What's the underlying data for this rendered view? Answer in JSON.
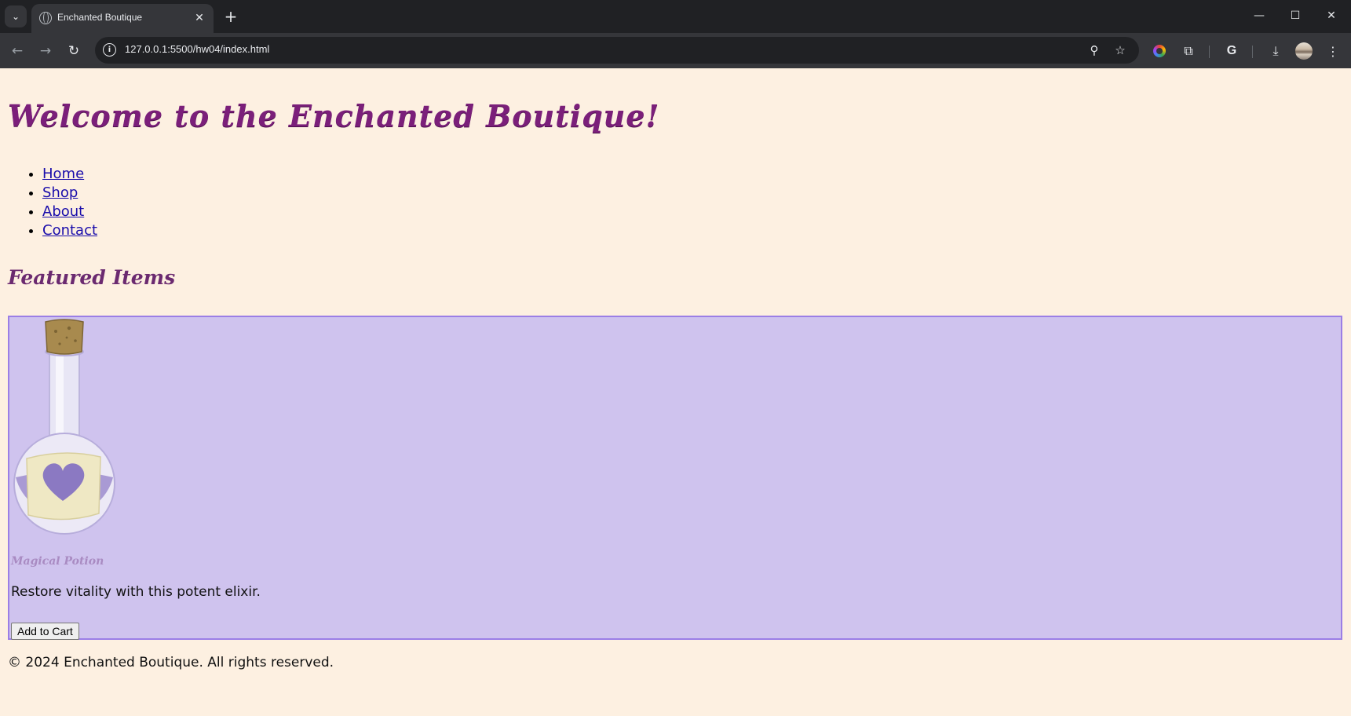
{
  "browser": {
    "tab_title": "Enchanted Boutique",
    "url": "127.0.0.1:5500/hw04/index.html",
    "new_tab_symbol": "+",
    "tab_close_symbol": "✕",
    "window_controls": {
      "minimize": "—",
      "maximize": "☐",
      "close": "✕"
    },
    "icons": [
      "tab-search-icon",
      "globe-icon",
      "back-icon",
      "forward-icon",
      "reload-icon",
      "site-info-icon",
      "zoom-icon",
      "bookmark-star-icon",
      "color-picker-icon",
      "extensions-icon",
      "google-icon",
      "download-icon",
      "profile-avatar-icon",
      "menu-icon"
    ]
  },
  "page": {
    "title": "Welcome to the Enchanted Boutique!",
    "nav": [
      {
        "label": "Home"
      },
      {
        "label": "Shop"
      },
      {
        "label": "About"
      },
      {
        "label": "Contact"
      }
    ],
    "section_title": "Featured Items",
    "product": {
      "name": "Magical Potion",
      "description": "Restore vitality with this potent elixir.",
      "button_label": "Add to Cart",
      "image": "potion-bottle-heart"
    },
    "footer": "© 2024 Enchanted Boutique. All rights reserved."
  },
  "colors": {
    "page_background": "#fdf0e1",
    "title_color": "#7b1f7a",
    "card_background": "#cfc3ee",
    "card_border": "#9b7ee6",
    "link_color": "#1a0dab"
  }
}
